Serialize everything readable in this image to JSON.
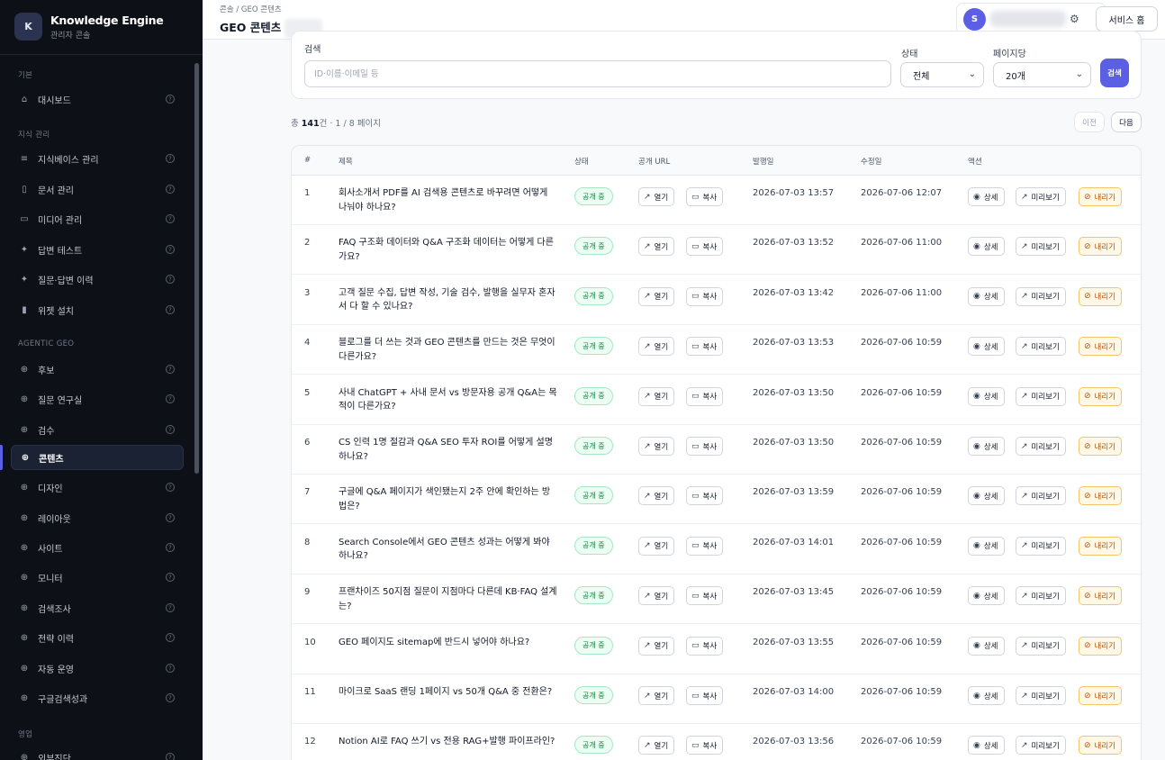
{
  "brand": {
    "logo_letter": "K",
    "name": "Knowledge Engine",
    "subtitle": "관리자 콘솔"
  },
  "sidebar": {
    "sections": [
      {
        "label": "기본"
      },
      {
        "label": "지식 관리"
      },
      {
        "label": "AGENTIC GEO"
      },
      {
        "label": "영업"
      }
    ],
    "items": [
      {
        "label": "대시보드",
        "icon": "home-icon"
      },
      {
        "label": "지식베이스 관리",
        "icon": "list-icon"
      },
      {
        "label": "문서 관리",
        "icon": "document-icon"
      },
      {
        "label": "미디어 관리",
        "icon": "image-icon"
      },
      {
        "label": "답변 테스트",
        "icon": "sparkle-icon"
      },
      {
        "label": "질문·답변 이력",
        "icon": "sparkle-icon"
      },
      {
        "label": "위젯 설치",
        "icon": "widget-icon"
      },
      {
        "label": "후보",
        "icon": "globe-icon"
      },
      {
        "label": "질문 연구실",
        "icon": "globe-icon"
      },
      {
        "label": "검수",
        "icon": "globe-icon"
      },
      {
        "label": "콘텐츠",
        "icon": "globe-icon",
        "active": true
      },
      {
        "label": "디자인",
        "icon": "globe-icon"
      },
      {
        "label": "레이아웃",
        "icon": "globe-icon"
      },
      {
        "label": "사이트",
        "icon": "globe-icon"
      },
      {
        "label": "모니터",
        "icon": "globe-icon"
      },
      {
        "label": "검색조사",
        "icon": "globe-icon"
      },
      {
        "label": "전략 이력",
        "icon": "globe-icon"
      },
      {
        "label": "자동 운영",
        "icon": "globe-icon"
      },
      {
        "label": "구글검색성과",
        "icon": "globe-icon"
      },
      {
        "label": "외부진단",
        "icon": "globe-icon"
      }
    ],
    "help_glyph": "?"
  },
  "header": {
    "breadcrumb": "콘솔  /  GEO 콘텐츠",
    "title": "GEO 콘텐츠",
    "user_initial": "S",
    "service_home_label": "서비스 홈"
  },
  "filters": {
    "search_label": "검색",
    "search_placeholder": "ID·이름·이메일 등",
    "status_label": "상태",
    "status_value": "전체",
    "page_size_label": "페이지당",
    "page_size_value": "20개",
    "search_button": "검색"
  },
  "summary": {
    "prefix": "총 ",
    "total": "141",
    "suffix": "건 · 1 / 8 페이지"
  },
  "pagination": {
    "prev": "이전",
    "next": "다음"
  },
  "table": {
    "columns": [
      "#",
      "제목",
      "상태",
      "공개 URL",
      "발행일",
      "수정일",
      "액션"
    ],
    "labels": {
      "open": "열기",
      "copy": "복사",
      "detail": "상세",
      "preview": "미리보기",
      "unpublish": "내리기"
    },
    "rows": [
      {
        "num": "1",
        "title": "회사소개서 PDF를 AI 검색용 콘텐츠로 바꾸려면 어떻게 나눠야 하나요?",
        "status": "공개 중",
        "published": "2026-07-03 13:57",
        "modified": "2026-07-06 12:07"
      },
      {
        "num": "2",
        "title": "FAQ 구조화 데이터와 Q&A 구조화 데이터는 어떻게 다른가요?",
        "status": "공개 중",
        "published": "2026-07-03 13:52",
        "modified": "2026-07-06 11:00"
      },
      {
        "num": "3",
        "title": "고객 질문 수집, 답변 작성, 기술 검수, 발행을 실무자 혼자서 다 할 수 있나요?",
        "status": "공개 중",
        "published": "2026-07-03 13:42",
        "modified": "2026-07-06 11:00"
      },
      {
        "num": "4",
        "title": "블로그를 더 쓰는 것과 GEO 콘텐츠를 만드는 것은 무엇이 다른가요?",
        "status": "공개 중",
        "published": "2026-07-03 13:53",
        "modified": "2026-07-06 10:59"
      },
      {
        "num": "5",
        "title": "사내 ChatGPT + 사내 문서 vs 방문자용 공개 Q&A는 목적이 다른가요?",
        "status": "공개 중",
        "published": "2026-07-03 13:50",
        "modified": "2026-07-06 10:59"
      },
      {
        "num": "6",
        "title": "CS 인력 1명 절감과 Q&A SEO 투자 ROI를 어떻게 설명하나요?",
        "status": "공개 중",
        "published": "2026-07-03 13:50",
        "modified": "2026-07-06 10:59"
      },
      {
        "num": "7",
        "title": "구글에 Q&A 페이지가 색인됐는지 2주 안에 확인하는 방법은?",
        "status": "공개 중",
        "published": "2026-07-03 13:59",
        "modified": "2026-07-06 10:59"
      },
      {
        "num": "8",
        "title": "Search Console에서 GEO 콘텐츠 성과는 어떻게 봐야 하나요?",
        "status": "공개 중",
        "published": "2026-07-03 14:01",
        "modified": "2026-07-06 10:59"
      },
      {
        "num": "9",
        "title": "프랜차이즈 50지점 질문이 지점마다 다른데 KB·FAQ 설계는?",
        "status": "공개 중",
        "published": "2026-07-03 13:45",
        "modified": "2026-07-06 10:59"
      },
      {
        "num": "10",
        "title": "GEO 페이지도 sitemap에 반드시 넣어야 하나요?",
        "status": "공개 중",
        "published": "2026-07-03 13:55",
        "modified": "2026-07-06 10:59"
      },
      {
        "num": "11",
        "title": "마이크로 SaaS 랜딩 1페이지 vs 50개 Q&A 중 전환은?",
        "status": "공개 중",
        "published": "2026-07-03 14:00",
        "modified": "2026-07-06 10:59"
      },
      {
        "num": "12",
        "title": "Notion AI로 FAQ 쓰기 vs 전용 RAG+발행 파이프라인?",
        "status": "공개 중",
        "published": "2026-07-03 13:56",
        "modified": "2026-07-06 10:59"
      }
    ]
  },
  "colors": {
    "accent": "#5b5fe3",
    "sidebar_bg": "#0d1117",
    "badge_green": "#15803d",
    "unpublish_amber": "#b45309"
  }
}
